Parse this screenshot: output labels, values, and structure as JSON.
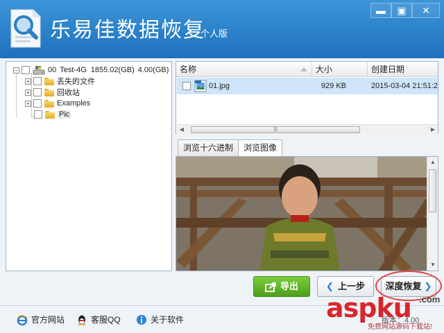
{
  "app": {
    "title": "乐易佳数据恢复",
    "edition": "个人版"
  },
  "window_controls": {
    "minimize": "▬",
    "restore": "▣",
    "close": "✕"
  },
  "tree": {
    "drive": {
      "index": "00",
      "name": "Test-4G",
      "size1": "1855.02(GB)",
      "size2": "4.00(GB)"
    },
    "items": [
      {
        "label": "丢失的文件"
      },
      {
        "label": "回收站"
      },
      {
        "label": "Examples"
      },
      {
        "label": "Pic"
      }
    ]
  },
  "file_list": {
    "columns": [
      "名称",
      "大小",
      "创建日期"
    ],
    "rows": [
      {
        "name": "01.jpg",
        "size": "929 KB",
        "date": "2015-03-04  21:51:2"
      }
    ]
  },
  "tabs": [
    {
      "label": "浏览十六进制"
    },
    {
      "label": "浏览图像"
    }
  ],
  "buttons": {
    "export": "导出",
    "prev": "上一步",
    "deep": "深度恢复"
  },
  "footer": {
    "links": [
      {
        "label": "官方网站",
        "icon": "ie-icon"
      },
      {
        "label": "客服QQ",
        "icon": "qq-penguin-icon"
      },
      {
        "label": "关于软件",
        "icon": "info-icon"
      }
    ],
    "version": "版本：4.00"
  },
  "watermark": {
    "brand": "aspku",
    "com": ".com",
    "sub": "免费网站源码下载站!"
  },
  "colors": {
    "titlebar": "#2a82cc",
    "export_green": "#5fb02a",
    "selected_row": "#cfe5fb",
    "accent_red": "#d8262b"
  }
}
